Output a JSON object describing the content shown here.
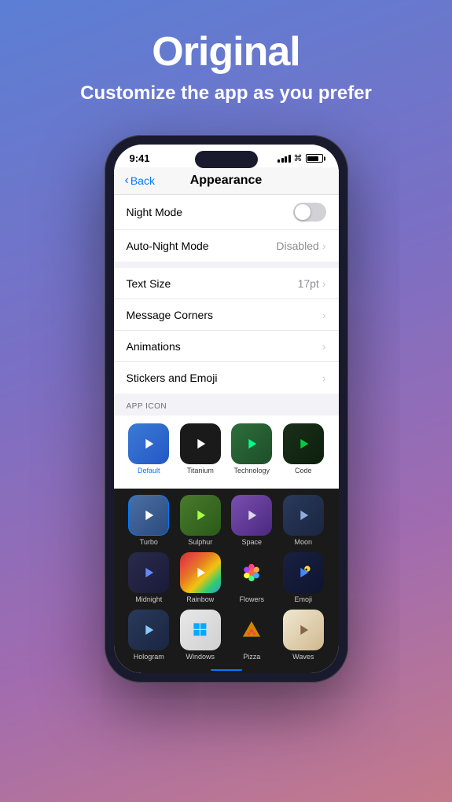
{
  "hero": {
    "title": "Original",
    "subtitle": "Customize the app\nas you prefer"
  },
  "phone": {
    "statusBar": {
      "time": "9:41",
      "signal": "signal",
      "wifi": "wifi",
      "battery": "battery"
    },
    "navBar": {
      "backLabel": "Back",
      "title": "Appearance"
    },
    "settings": {
      "items": [
        {
          "label": "Night Mode",
          "type": "toggle",
          "value": ""
        },
        {
          "label": "Auto-Night Mode",
          "type": "value",
          "value": "Disabled"
        },
        {
          "label": "Text Size",
          "type": "value",
          "value": "17pt"
        },
        {
          "label": "Message Corners",
          "type": "arrow",
          "value": ""
        },
        {
          "label": "Animations",
          "type": "arrow",
          "value": ""
        },
        {
          "label": "Stickers and Emoji",
          "type": "arrow",
          "value": ""
        }
      ],
      "sectionHeader": "APP ICON"
    },
    "appIcons": {
      "row1": [
        {
          "name": "Default",
          "style": "default",
          "selected": true
        },
        {
          "name": "Titanium",
          "style": "titanium",
          "selected": false
        },
        {
          "name": "Technology",
          "style": "technology",
          "selected": false
        },
        {
          "name": "Code",
          "style": "code",
          "selected": false
        }
      ],
      "row2": [
        {
          "name": "Turbo",
          "style": "turbo",
          "selected": false
        },
        {
          "name": "Sulphur",
          "style": "sulphur",
          "selected": false
        },
        {
          "name": "Space",
          "style": "space",
          "selected": false
        },
        {
          "name": "Moon",
          "style": "moon",
          "selected": false
        }
      ],
      "row3": [
        {
          "name": "Midnight",
          "style": "midnight",
          "selected": false
        },
        {
          "name": "Rainbow",
          "style": "rainbow",
          "selected": false
        },
        {
          "name": "Flowers",
          "style": "flowers",
          "selected": false
        },
        {
          "name": "Emoji",
          "style": "emoji",
          "selected": false
        }
      ],
      "row4": [
        {
          "name": "Hologram",
          "style": "hologram",
          "selected": false
        },
        {
          "name": "Windows",
          "style": "windows",
          "selected": false
        },
        {
          "name": "Pizza",
          "style": "pizza",
          "selected": false
        },
        {
          "name": "Waves",
          "style": "waves",
          "selected": false
        }
      ]
    }
  }
}
